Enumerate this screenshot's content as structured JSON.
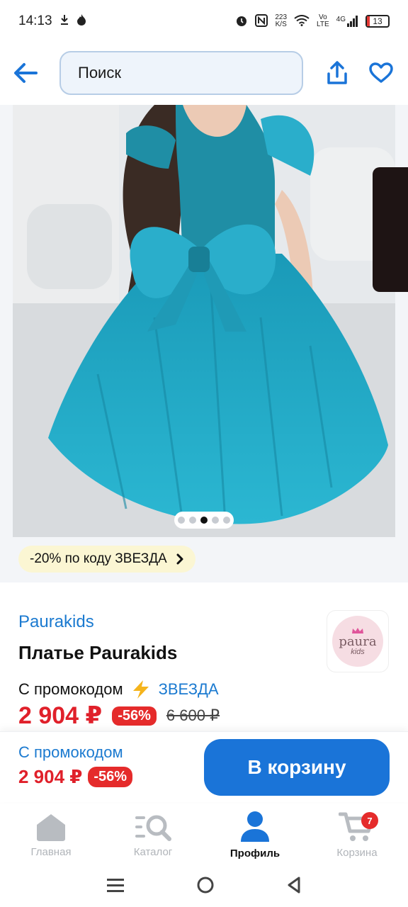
{
  "status_bar": {
    "time": "14:13",
    "net_speed_top": "223",
    "net_speed_bottom": "K/S",
    "volte_top": "Vo",
    "volte_bottom": "LTE",
    "network": "4G",
    "battery": "13"
  },
  "topbar": {
    "search_placeholder": "Поиск"
  },
  "gallery": {
    "dots_total": 5,
    "active_dot": 3,
    "promo_chip": "-20% по коду ЗВЕЗДА"
  },
  "product": {
    "brand": "Paurakids",
    "title": "Платье Paurakids",
    "promo_label": "С промокодом",
    "promo_code": "ЗВЕЗДА",
    "price": "2 904 ₽",
    "discount": "-56%",
    "old_price": "6 600 ₽",
    "logo_text": "paura",
    "logo_sub": "kids"
  },
  "buy_bar": {
    "promo_label": "С промокодом",
    "price": "2 904 ₽",
    "discount": "-56%",
    "cart_button": "В корзину"
  },
  "bottom_nav": {
    "items": [
      {
        "label": "Главная",
        "icon": "home-icon"
      },
      {
        "label": "Каталог",
        "icon": "catalog-icon"
      },
      {
        "label": "Профиль",
        "icon": "profile-icon"
      },
      {
        "label": "Корзина",
        "icon": "cart-icon",
        "badge": "7"
      }
    ],
    "active_index": 2
  },
  "colors": {
    "accent": "#1a74d8",
    "price_red": "#e0202a",
    "dress_teal": "#21a6c4"
  }
}
